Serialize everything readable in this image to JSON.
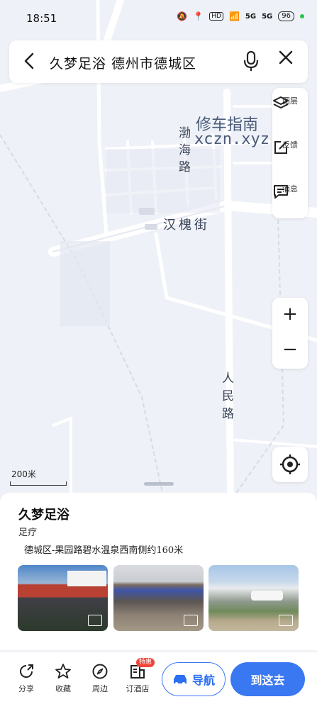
{
  "status_bar": {
    "time": "18:51",
    "battery": "96",
    "hd": "HD",
    "signal1": "5G",
    "signal2": "5G"
  },
  "search": {
    "query": "久梦足浴 德州市德城区"
  },
  "map": {
    "road_labels": [
      "渤海路",
      "汉槐街",
      "人民路"
    ],
    "watermark_line1": "修车指南",
    "watermark_line2": "xczn.xyz",
    "scale": "200米"
  },
  "tools": {
    "layers": "图层",
    "feedback": "反馈",
    "messages": "消息",
    "zoom_in": "+",
    "zoom_out": "−"
  },
  "poi": {
    "name": "久梦足浴",
    "category": "足疗",
    "address": "德城区-果园路碧水温泉西南侧约160米"
  },
  "bottom_bar": {
    "share": "分享",
    "favorite": "收藏",
    "nearby": "周边",
    "hotel": "订酒店",
    "hotel_tag": "特惠",
    "navigate": "导航",
    "go_here": "到这去"
  },
  "colors": {
    "accent": "#3a78f2",
    "tag": "#f0453a",
    "map_bg": "#eef1f7"
  }
}
